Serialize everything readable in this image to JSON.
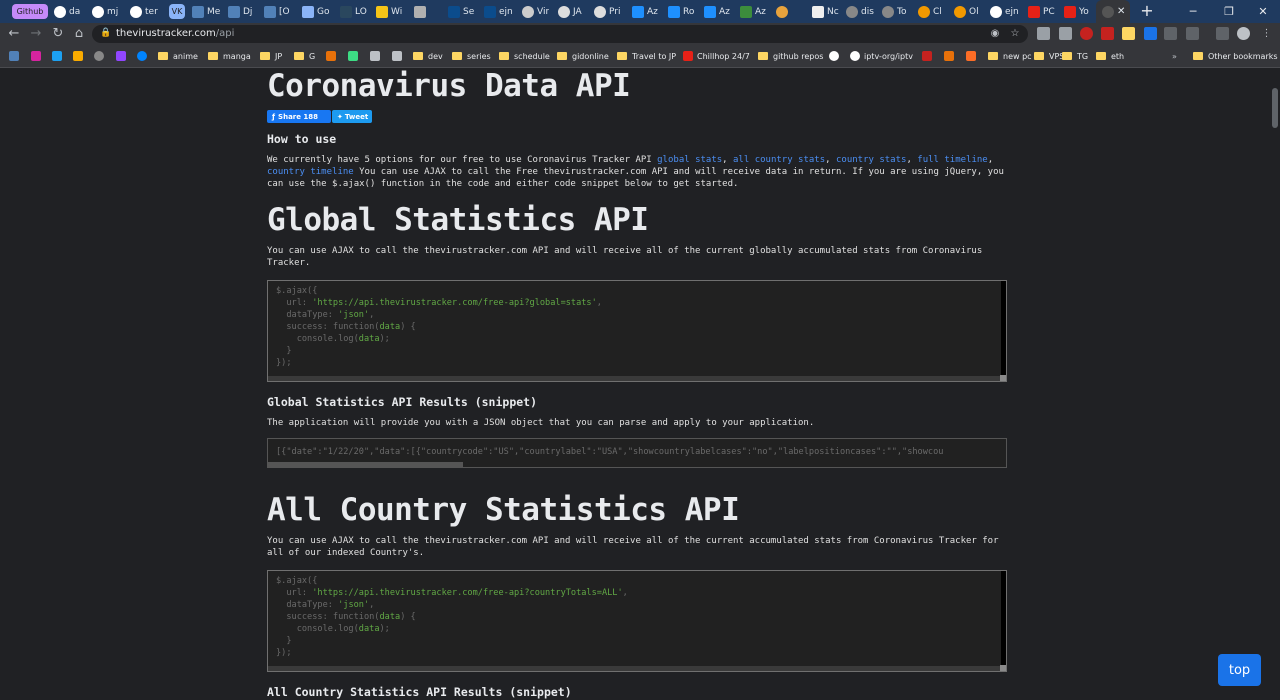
{
  "browser": {
    "tab_group_label": "Github",
    "tab_vk_label": "VK",
    "tabs": [
      "da",
      "mj",
      "ter",
      "Me",
      "Dj",
      "[O",
      "Go",
      "LO",
      "Wi",
      "",
      "Se",
      "ejn",
      "Vir",
      "JA",
      "Pri",
      "Az",
      "Ro",
      "Az",
      "Az",
      "",
      "Nc",
      "dis",
      "To",
      "Cl",
      "Ol",
      "ejn",
      "PC",
      "Yo"
    ],
    "url_host": "thevirustracker.com",
    "url_path": "/api"
  },
  "bookmarks": [
    "anime",
    "manga",
    "JP",
    "G",
    "dev",
    "series",
    "schedule",
    "gidonline",
    "Travel to JP",
    "Chillhop 24/7",
    "github repos",
    "iptv-org/iptv",
    "new pc",
    "VPS",
    "TG",
    "eth"
  ],
  "other_bookmarks": "Other bookmarks",
  "page": {
    "title": "Coronavirus Data API",
    "share_label": "Share 188",
    "tweet_label": "Tweet",
    "how_to_use": "How to use",
    "intro_before": "We currently have 5 options for our free to use Coronavirus Tracker API ",
    "links": [
      "global stats",
      "all country stats",
      "country stats",
      "full timeline",
      "country timeline"
    ],
    "intro_after": " You can use AJAX to call the Free thevirustracker.com API and will receive data in return. If you are using jQuery, you can use the $.ajax() function in the code and either code snippet below to get started.",
    "global": {
      "heading": "Global Statistics API",
      "desc": "You can use AJAX to call the thevirustracker.com API and will receive all of the current globally accumulated stats from Coronavirus Tracker.",
      "url": "'https://api.thevirustracker.com/free-api?global=stats'",
      "results_heading": "Global Statistics API Results (snippet)",
      "results_desc": "The application will provide you with a JSON object that you can parse and apply to your application.",
      "json_snippet": "[{\"date\":\"1/22/20\",\"data\":[{\"countrycode\":\"US\",\"countrylabel\":\"USA\",\"showcountrylabelcases\":\"no\",\"labelpositioncases\":\"\",\"showcou"
    },
    "all_country": {
      "heading": "All Country Statistics API",
      "desc": "You can use AJAX to call the thevirustracker.com API and will receive all of the current accumulated stats from Coronavirus Tracker for all of our indexed Country's.",
      "url": "'https://api.thevirustracker.com/free-api?countryTotals=ALL'",
      "results_heading": "All Country Statistics API Results (snippet)"
    },
    "code": {
      "line1": "$.ajax({",
      "url_key": "  url: ",
      "url_end": ",",
      "dtype_key": "  dataType: ",
      "dtype_val": "'json'",
      "dtype_end": ",",
      "success_a": "  success: function(",
      "success_arg": "data",
      "success_b": ") {",
      "log_a": "    console.log(",
      "log_arg": "data",
      "log_b": ");",
      "close1": "  }",
      "close2": "});"
    },
    "top_label": "top"
  }
}
